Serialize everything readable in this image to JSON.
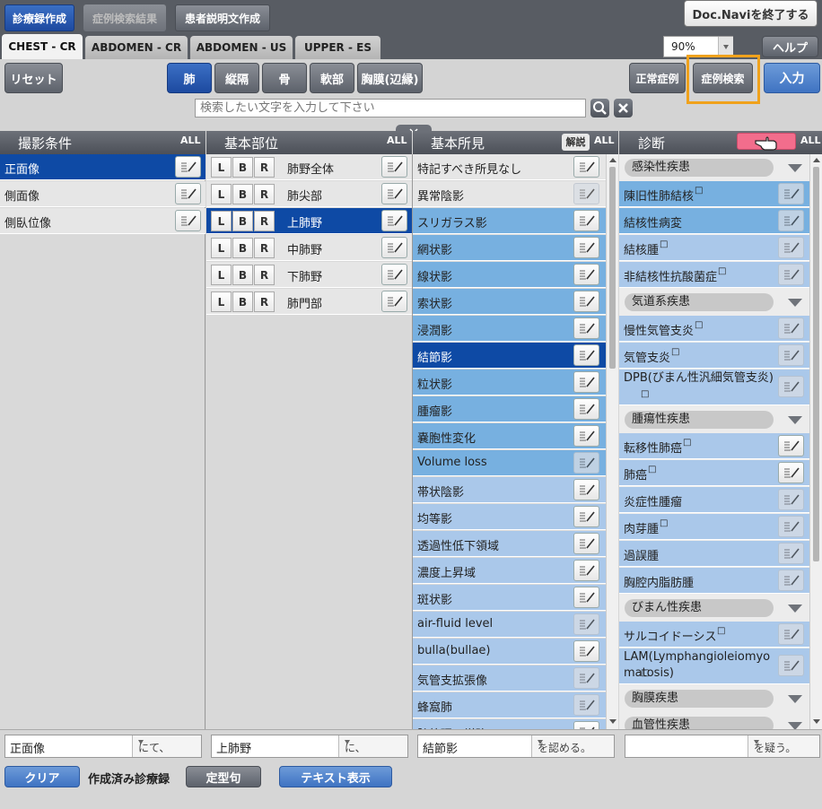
{
  "top_tabs": [
    "診療録作成",
    "症例検索結果",
    "患者説明文作成"
  ],
  "exit_label": "Doc.Naviを終了する",
  "modality_tabs": [
    "CHEST - CR",
    "ABDOMEN - CR",
    "ABDOMEN - US",
    "UPPER - ES"
  ],
  "zoom": "90%",
  "help_label": "ヘルプ",
  "reset_label": "リセット",
  "region_buttons": [
    "肺",
    "縦隔",
    "骨",
    "軟部",
    "胸膜(辺縁)"
  ],
  "normal_case_label": "正常症例",
  "case_search_label": "症例検索",
  "enter_label": "入力",
  "search": {
    "placeholder": "検索したい文字を入力して下さい"
  },
  "columns": {
    "conditions": {
      "title": "撮影条件",
      "all": "ALL",
      "items": [
        "正面像",
        "側面像",
        "側臥位像"
      ],
      "selected": 0
    },
    "sites": {
      "title": "基本部位",
      "all": "ALL",
      "lbr": [
        "L",
        "B",
        "R"
      ],
      "items": [
        "肺野全体",
        "肺尖部",
        "上肺野",
        "中肺野",
        "下肺野",
        "肺門部"
      ],
      "selected": 2
    },
    "findings": {
      "title": "基本所見",
      "explain": "解説",
      "all": "ALL",
      "items": [
        "特記すべき所見なし",
        "異常陰影",
        "スリガラス影",
        "網状影",
        "線状影",
        "索状影",
        "浸潤影",
        "結節影",
        "粒状影",
        "腫瘤影",
        "嚢胞性変化",
        "Volume loss",
        "帯状陰影",
        "均等影",
        "透過性低下領域",
        "濃度上昇域",
        "斑状影",
        "air-fluid level",
        "bulla(bullae)",
        "気管支拡張像",
        "蜂窩肺",
        "肺紋理の増強"
      ],
      "selected": 7
    },
    "diagnosis": {
      "title": "診断",
      "all": "ALL",
      "groups": [
        {
          "name": "感染性疾患",
          "items": [
            "陳旧性肺結核",
            "結核性病変",
            "結核腫",
            "非結核性抗酸菌症"
          ]
        },
        {
          "name": "気道系疾患",
          "items": [
            "慢性気管支炎",
            "気管支炎",
            "DPB(びまん性汎細気管支炎)"
          ]
        },
        {
          "name": "腫瘍性疾患",
          "items": [
            "転移性肺癌",
            "肺癌",
            "炎症性腫瘤",
            "肉芽腫",
            "過誤腫",
            "胸腔内脂肪腫"
          ]
        },
        {
          "name": "びまん性疾患",
          "items": [
            "サルコイドーシス",
            "LAM(Lymphangioleiomyomatosis)"
          ]
        },
        {
          "name": "胸膜疾患",
          "items": []
        },
        {
          "name": "血管性疾患",
          "items": []
        }
      ],
      "checkbox_mark": "□"
    }
  },
  "sentence": [
    {
      "value": "正面像",
      "suffix": "にて、"
    },
    {
      "value": "上肺野",
      "suffix": "に、"
    },
    {
      "value": "結節影",
      "suffix": "を認める。"
    },
    {
      "value": "",
      "suffix": "を疑う。"
    }
  ],
  "bottom": {
    "clear_label": "クリア",
    "record_label": "作成済み診療録",
    "template_label": "定型句",
    "text_label": "テキスト表示"
  }
}
